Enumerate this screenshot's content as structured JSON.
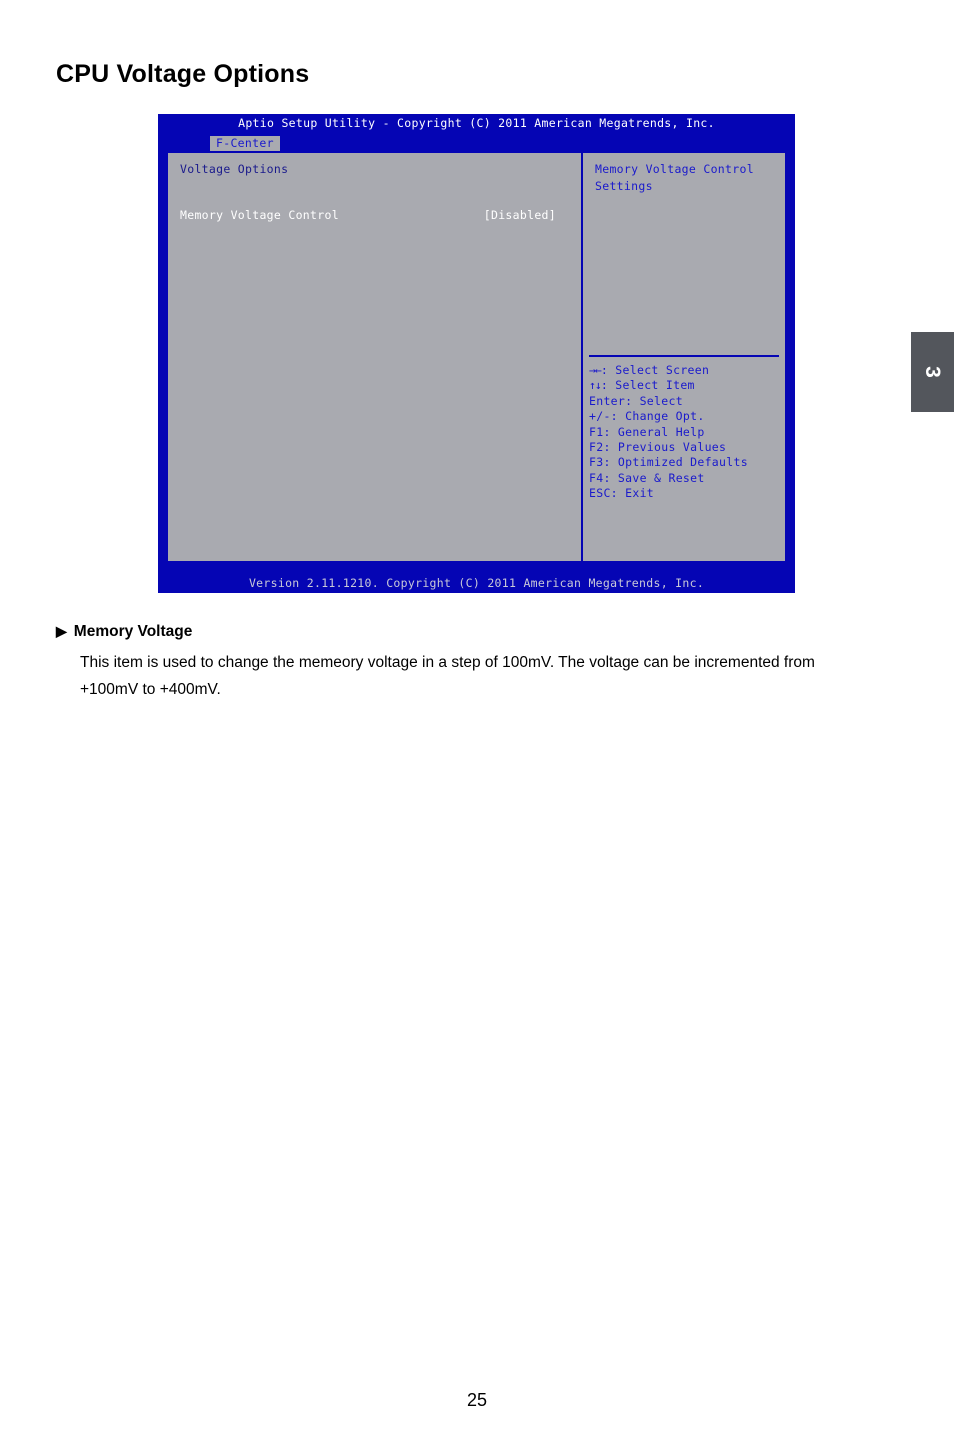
{
  "page": {
    "title": "CPU Voltage Options",
    "number": "25",
    "chapter_tab": "3"
  },
  "bios": {
    "titlebar": "Aptio Setup Utility - Copyright (C) 2011 American Megatrends, Inc.",
    "active_tab": "F-Center",
    "left_panel": {
      "section_title": "Voltage Options",
      "options": [
        {
          "label": "Memory Voltage Control",
          "value": "[Disabled]"
        }
      ]
    },
    "right_panel": {
      "help_line1": "Memory Voltage Control",
      "help_line2": "Settings",
      "nav_keys": [
        {
          "key": "→←",
          "text": ": Select Screen"
        },
        {
          "key": "↑↓",
          "text": ": Select Item"
        },
        {
          "key": "Enter",
          "text": ": Select"
        },
        {
          "key": "+/-",
          "text": ": Change Opt."
        },
        {
          "key": "F1",
          "text": ": General Help"
        },
        {
          "key": "F2",
          "text": ": Previous Values"
        },
        {
          "key": "F3",
          "text": ": Optimized Defaults"
        },
        {
          "key": "F4",
          "text": ": Save & Reset"
        },
        {
          "key": "ESC",
          "text": ": Exit"
        }
      ]
    },
    "footer": "Version 2.11.1210. Copyright (C) 2011 American Megatrends, Inc."
  },
  "description": {
    "bullet_marker": "▶",
    "heading": "Memory Voltage",
    "body": "This item is used to change the memeory voltage in a step of 100mV. The voltage can be incremented from +100mV to +400mV."
  }
}
